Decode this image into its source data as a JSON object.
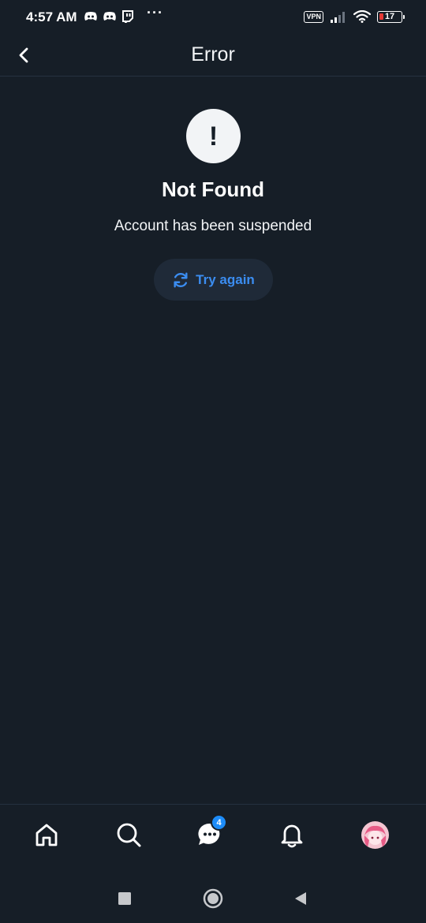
{
  "status_bar": {
    "time": "4:57 AM",
    "more_indicator": "···",
    "notification_icons": [
      "discord-icon",
      "discord-icon",
      "twitch-icon"
    ],
    "vpn_label": "VPN",
    "battery_level": "17",
    "battery_color": "#e53935"
  },
  "header": {
    "title": "Error"
  },
  "error": {
    "icon_glyph": "!",
    "heading": "Not Found",
    "message": "Account has been suspended",
    "retry_label": "Try again"
  },
  "bottom_nav": {
    "items": [
      "home-icon",
      "search-icon",
      "messages-icon",
      "notifications-icon",
      "profile-avatar"
    ],
    "messages_badge": "4"
  },
  "colors": {
    "background": "#161e27",
    "accent": "#3b8df1",
    "badge": "#1d8cf8"
  }
}
